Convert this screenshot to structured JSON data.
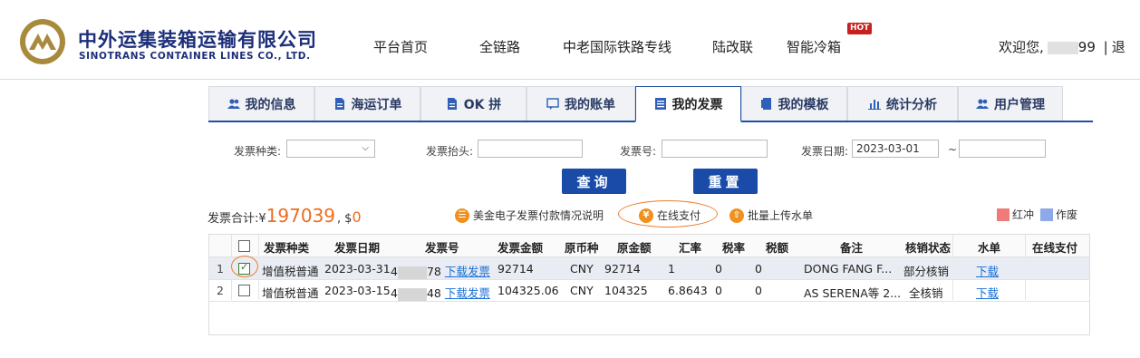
{
  "brand": {
    "name_cn": "中外运集装箱运输有限公司",
    "name_en": "SINOTRANS CONTAINER LINES CO., LTD."
  },
  "topnav": {
    "items": [
      "平台首页",
      "全链路",
      "中老国际铁路专线",
      "陆改联",
      "智能冷箱"
    ],
    "hot_badge": "HOT",
    "welcome": "欢迎您,",
    "welcome_user_tail": "99",
    "separator": "|",
    "logout_partial": "退"
  },
  "tabs": [
    {
      "label": "我的信息",
      "icon": "users-icon"
    },
    {
      "label": "海运订单",
      "icon": "document-icon"
    },
    {
      "label": "OK 拼",
      "icon": "document-icon"
    },
    {
      "label": "我的账单",
      "icon": "chat-icon"
    },
    {
      "label": "我的发票",
      "icon": "list-icon",
      "active": true
    },
    {
      "label": "我的模板",
      "icon": "file-icon"
    },
    {
      "label": "统计分析",
      "icon": "bar-chart-icon"
    },
    {
      "label": "用户管理",
      "icon": "users-icon"
    }
  ],
  "filters": {
    "type_label": "发票种类:",
    "title_label": "发票抬头:",
    "number_label": "发票号:",
    "date_label": "发票日期:",
    "date_from": "2023-03-01",
    "range_sep": "~",
    "date_to": ""
  },
  "buttons": {
    "query": "查询",
    "reset": "重置"
  },
  "summary": {
    "label": "发票合计:",
    "cny_prefix": "¥",
    "cny_amount": "197039",
    "sep": ",",
    "usd_prefix": "$",
    "usd_amount": "0"
  },
  "actions": {
    "payment_info": "美金电子发票付款情况说明",
    "online_pay": "在线支付",
    "batch_upload": "批量上传水单"
  },
  "legend": {
    "red_label": "红冲",
    "void_label": "作废",
    "red_color": "#f07a7a",
    "void_color": "#8ea9ea"
  },
  "table": {
    "headers": [
      "发票种类",
      "发票日期",
      "发票号",
      "发票金额",
      "原币种",
      "原金额",
      "汇率",
      "税率",
      "税额",
      "备注",
      "核销状态",
      "水单",
      "在线支付"
    ],
    "rows": [
      {
        "no": "1",
        "checked": true,
        "type": "增值税普通",
        "date": "2023-03-31",
        "inv_head": "4",
        "inv_tail": "78",
        "download": "下载发票",
        "amount": "92714",
        "currency": "CNY",
        "orig": "92714",
        "rate": "1",
        "tax_rate": "0",
        "tax": "0",
        "remark": "DONG FANG F...",
        "status": "部分核销",
        "slip": "下载"
      },
      {
        "no": "2",
        "checked": false,
        "type": "增值税普通",
        "date": "2023-03-15",
        "inv_head": "4",
        "inv_tail": "48",
        "download": "下载发票",
        "amount": "104325.06",
        "currency": "CNY",
        "orig": "104325",
        "rate": "6.8643",
        "tax_rate": "0",
        "tax": "0",
        "remark": "AS SERENA等 2...",
        "status": "全核销",
        "slip": "下载"
      }
    ]
  },
  "colors": {
    "brand_blue": "#1d2f7a",
    "accent_blue": "#1a4ba8",
    "highlight_orange": "#ed6d1f"
  }
}
